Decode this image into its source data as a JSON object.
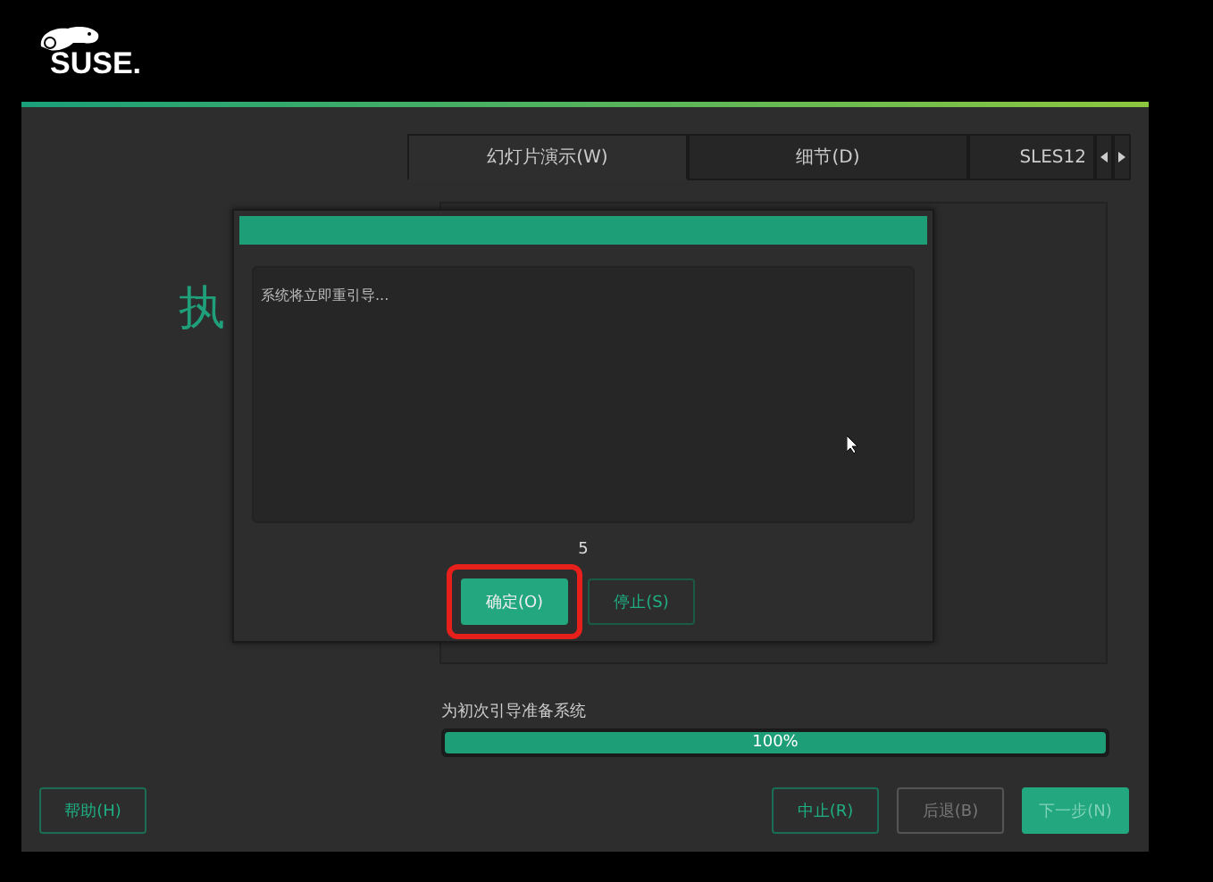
{
  "logo_text": "SUSE.",
  "tabs": [
    {
      "label": "幻灯片演示(W)",
      "selected": true
    },
    {
      "label": "细节(D)",
      "selected": false
    },
    {
      "label": "SLES12",
      "selected": false
    }
  ],
  "heading": "执",
  "dialog": {
    "message": "系统将立即重引导...",
    "countdown": "5",
    "buttons": [
      {
        "label": "确定(O)",
        "kind": "primary",
        "highlighted": true
      },
      {
        "label": "停止(S)",
        "kind": "secondary",
        "highlighted": false
      }
    ]
  },
  "progress": {
    "label": "为初次引导准备系统",
    "level": 1.0,
    "reading": "100%"
  },
  "buttons": [
    {
      "label": "帮助(H)",
      "kind": "outline",
      "disabled": false
    },
    {
      "label": "中止(R)",
      "kind": "outline",
      "disabled": false
    },
    {
      "label": "后退(B)",
      "kind": "outline",
      "disabled": true
    },
    {
      "label": "下一步(N)",
      "kind": "primary",
      "disabled": true
    }
  ]
}
